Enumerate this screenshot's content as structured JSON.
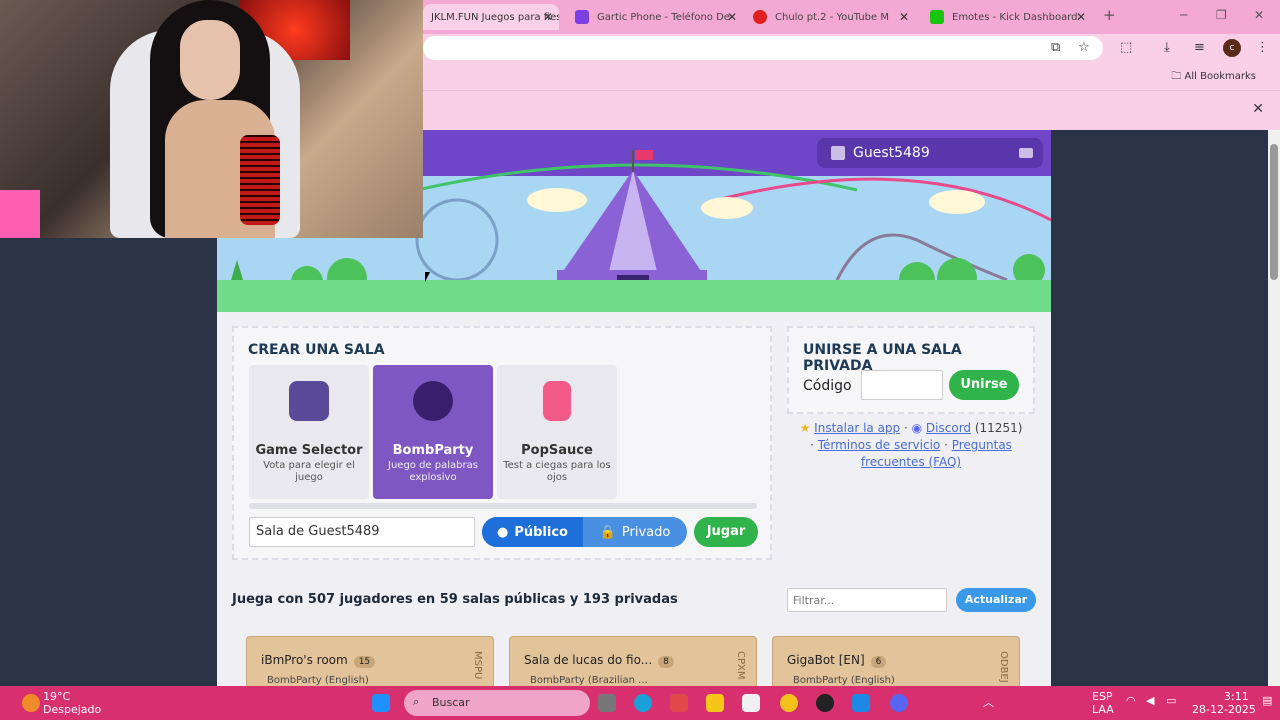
{
  "browser": {
    "tabs": [
      {
        "label": "JKLM.FUN Juegos para fiestas",
        "active": true
      },
      {
        "label": "Gartic Phone - Teléfono De",
        "active": false
      },
      {
        "label": "Chulo pt.2 - YouTube M",
        "active": false
      },
      {
        "label": "Emotes - Kick Dashboard",
        "active": false
      }
    ],
    "new_tab": "+",
    "all_bookmarks": "All Bookmarks",
    "profile_initial": "c"
  },
  "header": {
    "username": "Guest5489"
  },
  "create_room": {
    "title": "CREAR UNA SALA",
    "games": [
      {
        "name": "Game Selector",
        "desc": "Vota para elegir el juego",
        "selected": false
      },
      {
        "name": "BombParty",
        "desc": "Juego de palabras explosivo",
        "selected": true
      },
      {
        "name": "PopSauce",
        "desc": "Test a ciegas para los ojos",
        "selected": false
      }
    ],
    "room_name_value": "Sala de Guest5489",
    "public_label": "Público",
    "private_label": "Privado",
    "play_label": "Jugar"
  },
  "join_room": {
    "title": "UNIRSE A UNA SALA PRIVADA",
    "code_label": "Código",
    "join_label": "Unirse"
  },
  "links": {
    "install": "Instalar la app",
    "sep1": " · ",
    "discord": "Discord",
    "discord_count": "(11251)",
    "sep2": "· ",
    "terms": "Términos de servicio",
    "sep3": " · ",
    "faq": "Preguntas frecuentes (FAQ)"
  },
  "rooms": {
    "summary": "Juega con 507 jugadores en 59 salas públicas y 193 privadas",
    "filter_placeholder": "Filtrar...",
    "refresh_label": "Actualizar",
    "list": [
      {
        "name": "iBmPro's room",
        "count": "15",
        "game": "BombParty (English)",
        "code": "MSPU"
      },
      {
        "name": "Sala de lucas do fio...",
        "count": "8",
        "game": "BombParty (Brazilian ...",
        "code": "CPXM"
      },
      {
        "name": "GigaBot [EN]",
        "count": "6",
        "game": "BombParty (English)",
        "code": "ODBEJ"
      }
    ]
  },
  "taskbar": {
    "temp": "19°C",
    "weather": "Despejado",
    "search": "Buscar",
    "lang1": "ESP",
    "lang2": "LAA",
    "time": "3:11",
    "date": "28-12-2025"
  },
  "colors": {
    "site_purple": "#6e46c7",
    "green": "#2fb34a",
    "blue": "#1e6fd9",
    "taskbar": "#d8306e"
  }
}
